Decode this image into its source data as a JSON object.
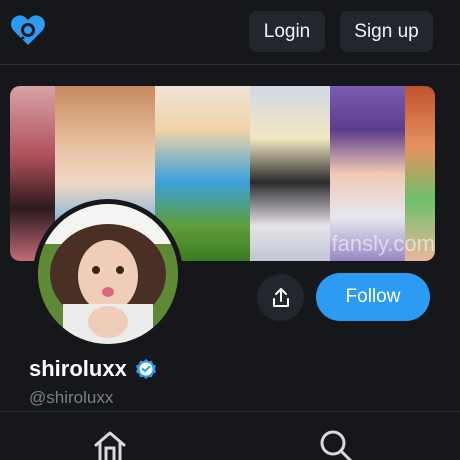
{
  "header": {
    "logo_icon": "fansly-heart-logo-icon",
    "login_label": "Login",
    "signup_label": "Sign up"
  },
  "banner": {
    "watermark": "fansly.com"
  },
  "profile": {
    "display_name": "shiroluxx",
    "handle": "@shiroluxx",
    "verified_icon": "verified-check-icon",
    "follow_label": "Follow",
    "share_icon": "share-icon"
  },
  "bottom_nav": {
    "items": [
      "home-icon",
      "search-icon"
    ]
  },
  "colors": {
    "background": "#16171b",
    "accent": "#2b9bf4",
    "button_dark": "#23262c",
    "handle_text": "#7a7f88"
  }
}
